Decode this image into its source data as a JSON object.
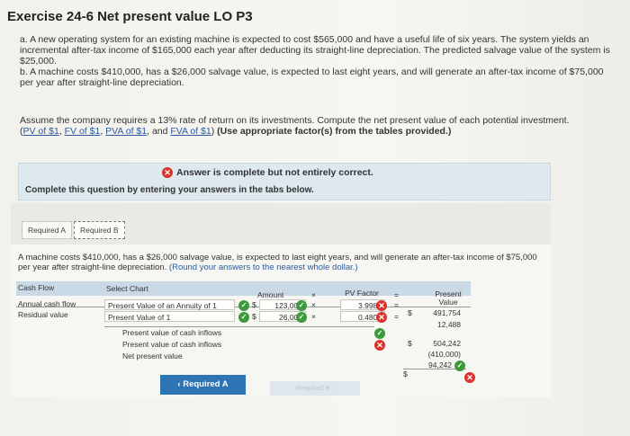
{
  "header": {
    "title": "Exercise 24-6 Net present value LO P3"
  },
  "question": {
    "a": "a. A new operating system for an existing machine is expected to cost $565,000 and have a useful life of six years. The system yields an incremental after-tax income of $165,000 each year after deducting its straight-line depreciation. The predicted salvage value of the system is $25,000.",
    "b": "b. A machine costs $410,000, has a $26,000 salvage value, is expected to last eight years, and will generate an after-tax income of $75,000 per year after straight-line depreciation.",
    "assume": "Assume the company requires a 13% rate of return on its investments. Compute the net present value of each potential investment.",
    "links": [
      "PV of $1",
      "FV of $1",
      "PVA of $1",
      "FVA of $1"
    ],
    "links_joiner": ", ",
    "links_and": ", and ",
    "instruction": "(Use appropriate factor(s) from the tables provided.)"
  },
  "status": {
    "message": "Answer is complete but not entirely correct.",
    "complete_text": "Complete this question by entering your answers in the tabs below."
  },
  "tabs": [
    {
      "label": "Required A"
    },
    {
      "label": "Required B"
    }
  ],
  "content": {
    "description": "A machine costs $410,000, has a $26,000 salvage value, is expected to last eight years, and will generate an after-tax income of $75,000 per year after straight-line depreciation.",
    "round_note": "(Round your answers to the nearest whole dollar.)"
  },
  "table": {
    "headers": {
      "cash_flow": "Cash Flow",
      "select_chart": "Select Chart",
      "amount": "Amount",
      "times": "×",
      "pv_factor": "PV Factor",
      "equals": "=",
      "present_value": "Present Value"
    },
    "rows": [
      {
        "cash_flow": "Annual cash flow",
        "chart": "Present Value of an Annuity of 1",
        "currency": "$",
        "amount": "123,000",
        "times": "×",
        "factor": "3.9980",
        "equals": "=",
        "pv_currency": "$",
        "pv": "491,754"
      },
      {
        "cash_flow": "Residual value",
        "chart": "Present Value of 1",
        "currency": "$",
        "amount": "26,000",
        "times": "×",
        "factor": "0.4803",
        "equals": "=",
        "pv_currency": "",
        "pv": "12,488"
      }
    ],
    "summary": [
      {
        "label": "Present value of cash inflows",
        "currency": "$",
        "value": "504,242"
      },
      {
        "label": "Present value of cash inflows",
        "currency": "",
        "value": "(410,000)"
      },
      {
        "label": "Net present value",
        "currency": "$",
        "value": "94,242"
      }
    ]
  },
  "nav": {
    "prev": "Required A",
    "next": "Required B"
  },
  "colors": {
    "correct": "#3c9a3c",
    "incorrect": "#d9332c",
    "button": "#2d74b5"
  }
}
